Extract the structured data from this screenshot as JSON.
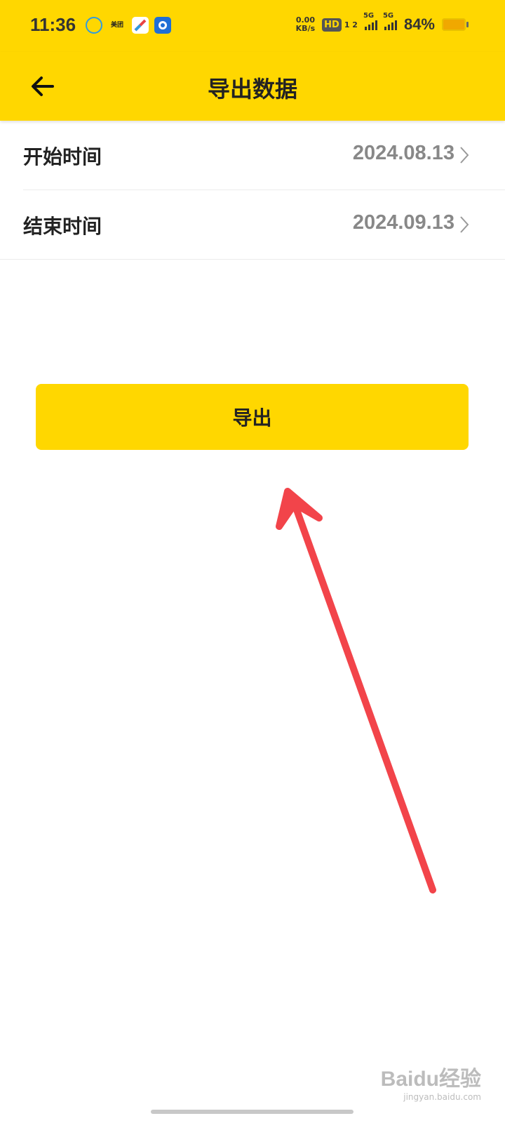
{
  "status_bar": {
    "time": "11:36",
    "net_speed_value": "0.00",
    "net_speed_unit": "KB/s",
    "hd_badge": "HD",
    "hd_sub": "1 2",
    "network_1": "5G",
    "network_2": "5G",
    "battery_percent": "84%",
    "app_icons": [
      "weather-icon",
      "meituan-icon",
      "compass-icon",
      "app-icon"
    ],
    "meituan_label": "美团"
  },
  "header": {
    "title": "导出数据",
    "back_icon": "arrow-left-icon"
  },
  "rows": [
    {
      "label": "开始时间",
      "value": "2024.08.13"
    },
    {
      "label": "结束时间",
      "value": "2024.09.13"
    }
  ],
  "export_button": {
    "label": "导出"
  },
  "watermark": {
    "main": "Baidu经验",
    "sub": "jingyan.baidu.com"
  },
  "colors": {
    "brand": "#FFD700",
    "arrow": "#F2444A",
    "value_text": "#888888"
  }
}
